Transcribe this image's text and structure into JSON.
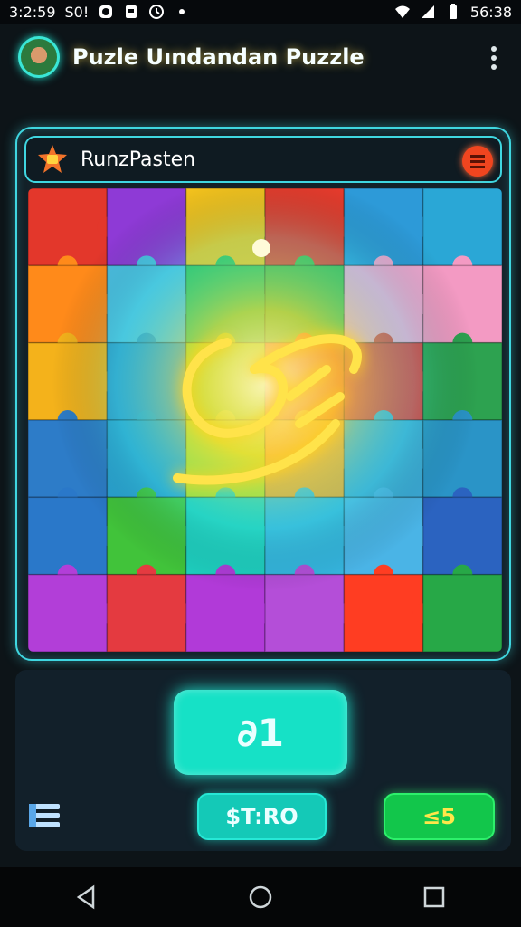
{
  "status_bar": {
    "time_left": "3:2:59",
    "carrier": "S0!",
    "time_right": "56:38",
    "icons": [
      "notification-icon",
      "clipboard-icon",
      "alarm-icon",
      "dot-icon",
      "wifi-icon",
      "signal-icon",
      "battery-icon"
    ]
  },
  "app_bar": {
    "title": "Puzle Uındandan Puzzle",
    "menu_icon": "more-vert-icon"
  },
  "panel": {
    "header_title": "RunzPasten",
    "header_icon": "puzzle-badge-icon",
    "action_icon": "menu-circle-icon"
  },
  "puzzle": {
    "grid_cols": 6,
    "grid_rows": 6,
    "colors": [
      "#e3372b",
      "#8e3ad6",
      "#f4c31d",
      "#e63b2c",
      "#2d9ad8",
      "#2aa7d6",
      "#ff8a1a",
      "#4cc0e4",
      "#2fc15a",
      "#42b84a",
      "#f2a8d2",
      "#f39ac3",
      "#f4b21b",
      "#2f9fd0",
      "#8fd81c",
      "#e85a2c",
      "#dd3e3f",
      "#2da250",
      "#2d7cc8",
      "#2aa4d4",
      "#b6e01b",
      "#f1a32a",
      "#3caad8",
      "#2a94c7",
      "#2a78c9",
      "#41c33a",
      "#1ed0c0",
      "#35b6e0",
      "#4ab4e6",
      "#2b63c0",
      "#b23ed8",
      "#e43a40",
      "#b13ad8",
      "#b44ed8",
      "#ff3d22",
      "#27a847"
    ]
  },
  "controls": {
    "main_button_label": "∂1",
    "stop_label": "$T:RO",
    "score_label": "≤5",
    "list_icon": "list-menu-icon"
  },
  "nav": {
    "back_icon": "back-triangle-icon",
    "home_icon": "home-circle-icon",
    "recents_icon": "recents-square-icon"
  }
}
